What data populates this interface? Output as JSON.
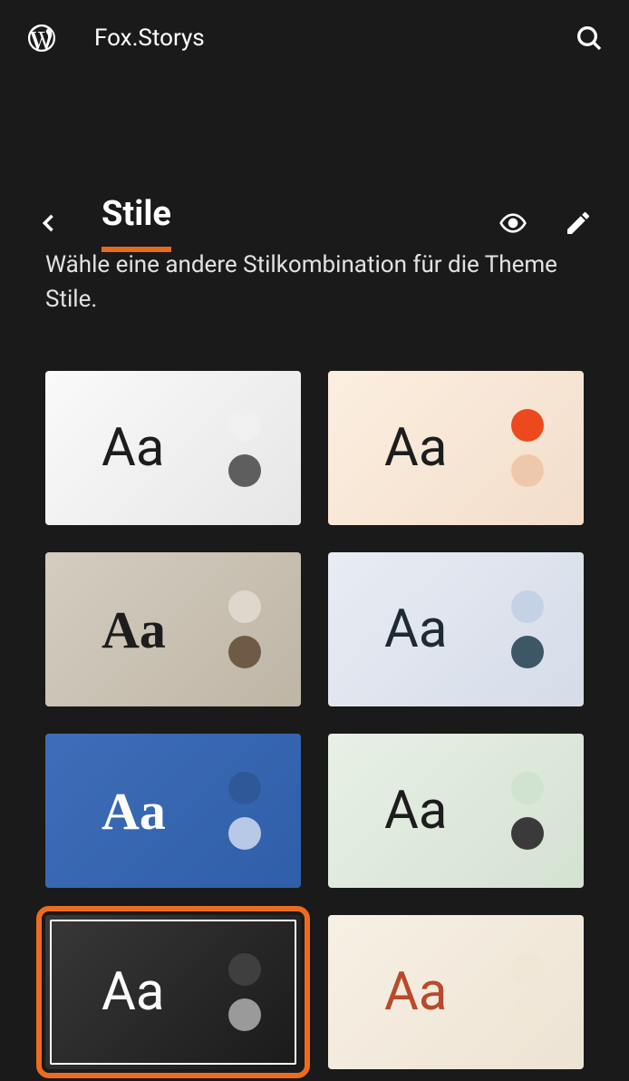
{
  "header": {
    "site_title": "Fox.Storys"
  },
  "page": {
    "title": "Stile",
    "description_line1": "Wähle eine andere Stilkombination für die Theme",
    "description_line2": "Stile."
  },
  "styles": [
    {
      "bg": "linear-gradient(135deg, #fafafa 0%, #e6e6e6 100%)",
      "text_color": "#1d1d1d",
      "serif": false,
      "dot_top": "#f0f0f0",
      "dot_bottom": "#5e5e5e",
      "selected": false,
      "label": "Aa"
    },
    {
      "bg": "linear-gradient(135deg, #fcefe0 0%, #f3ddcb 100%)",
      "text_color": "#1d1d1d",
      "serif": false,
      "dot_top": "#ec4a1c",
      "dot_bottom": "#efc8ab",
      "selected": false,
      "label": "Aa"
    },
    {
      "bg": "linear-gradient(135deg, #d4cdc0 0%, #beb5a5 100%)",
      "text_color": "#1d1d1d",
      "serif": true,
      "dot_top": "#ded8cc",
      "dot_bottom": "#6f5a46",
      "selected": false,
      "label": "Aa"
    },
    {
      "bg": "linear-gradient(135deg, #e8ecf3 0%, #d5dce8 100%)",
      "text_color": "#1f2a33",
      "serif": false,
      "dot_top": "#c5d2e5",
      "dot_bottom": "#3d5766",
      "selected": false,
      "label": "Aa"
    },
    {
      "bg": "linear-gradient(135deg, #3f6db8 0%, #2f5fa8 100%)",
      "text_color": "#ffffff",
      "serif": true,
      "dot_top": "#2f5899",
      "dot_bottom": "#b8c9e8",
      "selected": false,
      "label": "Aa"
    },
    {
      "bg": "linear-gradient(135deg, #e8f0e6 0%, #d4e2d2 100%)",
      "text_color": "#1d1d1d",
      "serif": false,
      "dot_top": "#d0e2d0",
      "dot_bottom": "#3a3a3a",
      "selected": false,
      "label": "Aa"
    },
    {
      "bg": "linear-gradient(135deg, #383838 0%, #1a1a1a 100%)",
      "text_color": "#ffffff",
      "serif": false,
      "dot_top": "#3f3f3f",
      "dot_bottom": "#9a9a9a",
      "selected": true,
      "label": "Aa"
    },
    {
      "bg": "linear-gradient(135deg, #f7f0e4 0%, #ede3d3 100%)",
      "text_color": "#b84a2b",
      "serif": false,
      "dot_top": "#efe6d5",
      "dot_bottom": "#efe6d5",
      "selected": false,
      "label": "Aa"
    }
  ]
}
